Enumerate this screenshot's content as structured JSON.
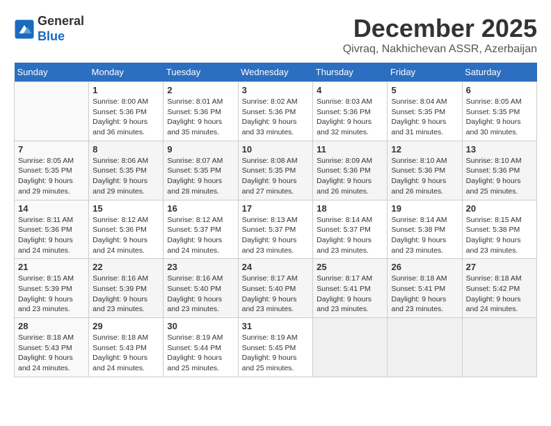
{
  "header": {
    "logo_line1": "General",
    "logo_line2": "Blue",
    "month_title": "December 2025",
    "location": "Qivraq, Nakhichevan ASSR, Azerbaijan"
  },
  "weekdays": [
    "Sunday",
    "Monday",
    "Tuesday",
    "Wednesday",
    "Thursday",
    "Friday",
    "Saturday"
  ],
  "weeks": [
    [
      {
        "day": "",
        "info": ""
      },
      {
        "day": "1",
        "info": "Sunrise: 8:00 AM\nSunset: 5:36 PM\nDaylight: 9 hours\nand 36 minutes."
      },
      {
        "day": "2",
        "info": "Sunrise: 8:01 AM\nSunset: 5:36 PM\nDaylight: 9 hours\nand 35 minutes."
      },
      {
        "day": "3",
        "info": "Sunrise: 8:02 AM\nSunset: 5:36 PM\nDaylight: 9 hours\nand 33 minutes."
      },
      {
        "day": "4",
        "info": "Sunrise: 8:03 AM\nSunset: 5:36 PM\nDaylight: 9 hours\nand 32 minutes."
      },
      {
        "day": "5",
        "info": "Sunrise: 8:04 AM\nSunset: 5:35 PM\nDaylight: 9 hours\nand 31 minutes."
      },
      {
        "day": "6",
        "info": "Sunrise: 8:05 AM\nSunset: 5:35 PM\nDaylight: 9 hours\nand 30 minutes."
      }
    ],
    [
      {
        "day": "7",
        "info": "Sunrise: 8:05 AM\nSunset: 5:35 PM\nDaylight: 9 hours\nand 29 minutes."
      },
      {
        "day": "8",
        "info": "Sunrise: 8:06 AM\nSunset: 5:35 PM\nDaylight: 9 hours\nand 29 minutes."
      },
      {
        "day": "9",
        "info": "Sunrise: 8:07 AM\nSunset: 5:35 PM\nDaylight: 9 hours\nand 28 minutes."
      },
      {
        "day": "10",
        "info": "Sunrise: 8:08 AM\nSunset: 5:35 PM\nDaylight: 9 hours\nand 27 minutes."
      },
      {
        "day": "11",
        "info": "Sunrise: 8:09 AM\nSunset: 5:36 PM\nDaylight: 9 hours\nand 26 minutes."
      },
      {
        "day": "12",
        "info": "Sunrise: 8:10 AM\nSunset: 5:36 PM\nDaylight: 9 hours\nand 26 minutes."
      },
      {
        "day": "13",
        "info": "Sunrise: 8:10 AM\nSunset: 5:36 PM\nDaylight: 9 hours\nand 25 minutes."
      }
    ],
    [
      {
        "day": "14",
        "info": "Sunrise: 8:11 AM\nSunset: 5:36 PM\nDaylight: 9 hours\nand 24 minutes."
      },
      {
        "day": "15",
        "info": "Sunrise: 8:12 AM\nSunset: 5:36 PM\nDaylight: 9 hours\nand 24 minutes."
      },
      {
        "day": "16",
        "info": "Sunrise: 8:12 AM\nSunset: 5:37 PM\nDaylight: 9 hours\nand 24 minutes."
      },
      {
        "day": "17",
        "info": "Sunrise: 8:13 AM\nSunset: 5:37 PM\nDaylight: 9 hours\nand 23 minutes."
      },
      {
        "day": "18",
        "info": "Sunrise: 8:14 AM\nSunset: 5:37 PM\nDaylight: 9 hours\nand 23 minutes."
      },
      {
        "day": "19",
        "info": "Sunrise: 8:14 AM\nSunset: 5:38 PM\nDaylight: 9 hours\nand 23 minutes."
      },
      {
        "day": "20",
        "info": "Sunrise: 8:15 AM\nSunset: 5:38 PM\nDaylight: 9 hours\nand 23 minutes."
      }
    ],
    [
      {
        "day": "21",
        "info": "Sunrise: 8:15 AM\nSunset: 5:39 PM\nDaylight: 9 hours\nand 23 minutes."
      },
      {
        "day": "22",
        "info": "Sunrise: 8:16 AM\nSunset: 5:39 PM\nDaylight: 9 hours\nand 23 minutes."
      },
      {
        "day": "23",
        "info": "Sunrise: 8:16 AM\nSunset: 5:40 PM\nDaylight: 9 hours\nand 23 minutes."
      },
      {
        "day": "24",
        "info": "Sunrise: 8:17 AM\nSunset: 5:40 PM\nDaylight: 9 hours\nand 23 minutes."
      },
      {
        "day": "25",
        "info": "Sunrise: 8:17 AM\nSunset: 5:41 PM\nDaylight: 9 hours\nand 23 minutes."
      },
      {
        "day": "26",
        "info": "Sunrise: 8:18 AM\nSunset: 5:41 PM\nDaylight: 9 hours\nand 23 minutes."
      },
      {
        "day": "27",
        "info": "Sunrise: 8:18 AM\nSunset: 5:42 PM\nDaylight: 9 hours\nand 24 minutes."
      }
    ],
    [
      {
        "day": "28",
        "info": "Sunrise: 8:18 AM\nSunset: 5:43 PM\nDaylight: 9 hours\nand 24 minutes."
      },
      {
        "day": "29",
        "info": "Sunrise: 8:18 AM\nSunset: 5:43 PM\nDaylight: 9 hours\nand 24 minutes."
      },
      {
        "day": "30",
        "info": "Sunrise: 8:19 AM\nSunset: 5:44 PM\nDaylight: 9 hours\nand 25 minutes."
      },
      {
        "day": "31",
        "info": "Sunrise: 8:19 AM\nSunset: 5:45 PM\nDaylight: 9 hours\nand 25 minutes."
      },
      {
        "day": "",
        "info": ""
      },
      {
        "day": "",
        "info": ""
      },
      {
        "day": "",
        "info": ""
      }
    ]
  ]
}
